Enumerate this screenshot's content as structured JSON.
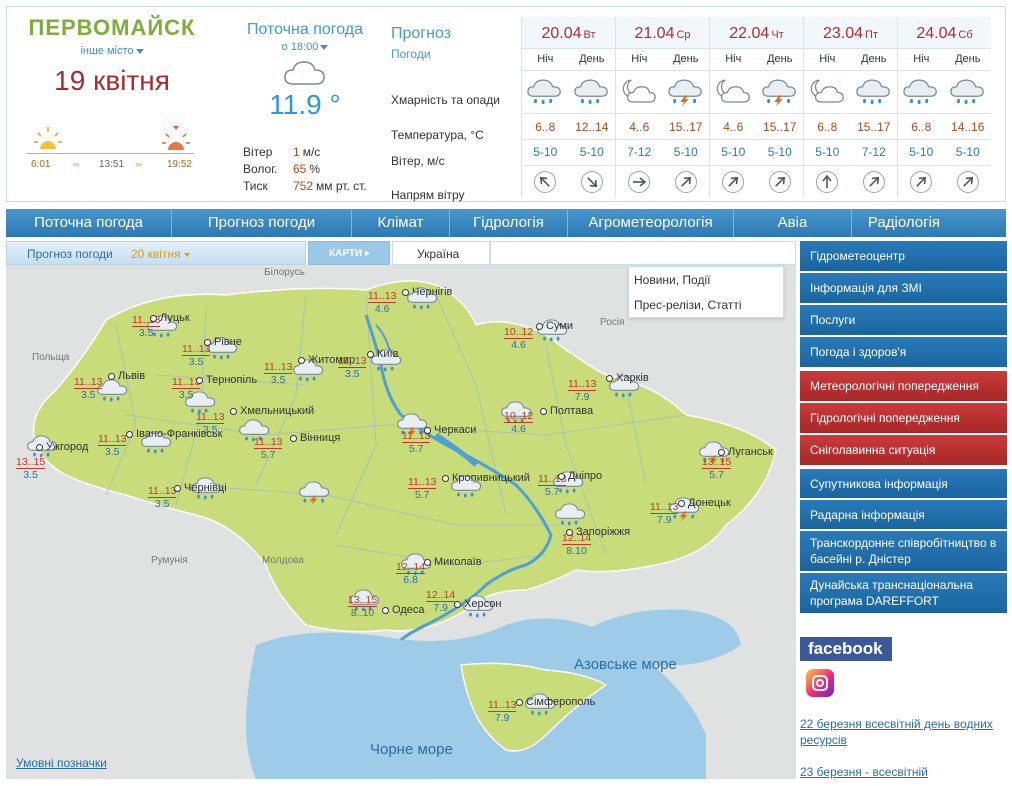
{
  "header": {
    "city": "ПЕРВОМАЙСК",
    "other_city": "інше місто",
    "date": "19 квітня",
    "sunrise": "6:01",
    "noon": "13:51",
    "sunset": "19:52"
  },
  "current": {
    "title": "Поточна погода",
    "time": "о 18:00",
    "temperature": "11.9 °",
    "wind_label": "Вітер",
    "wind_value": "1",
    "wind_unit": "м/с",
    "humidity_label": "Волог.",
    "humidity_value": "65",
    "humidity_unit": "%",
    "pressure_label": "Тиск",
    "pressure_value": "752",
    "pressure_unit": "мм рт. ст."
  },
  "forecast": {
    "title": "Прогноз",
    "subtitle": "Погоди",
    "row_clouds": "Хмарність та опади",
    "row_temp": "Температура, °С",
    "row_wind": "Вітер, м/с",
    "row_dir": "Напрям вітру",
    "night_label": "Ніч",
    "day_label": "День",
    "days": [
      {
        "date": "20.04",
        "dow": "Вт",
        "night": {
          "icon": "cloud-rain-icon",
          "temp": "6..8",
          "wind": "5-10",
          "dir": "nw"
        },
        "day": {
          "icon": "cloud-rain-icon",
          "temp": "12..14",
          "wind": "5-10",
          "dir": "se"
        }
      },
      {
        "date": "21.04",
        "dow": "Ср",
        "night": {
          "icon": "moon-cloud-icon",
          "temp": "4..6",
          "wind": "7-12",
          "dir": "e"
        },
        "day": {
          "icon": "cloud-thunder-icon",
          "temp": "15..17",
          "wind": "5-10",
          "dir": "ne"
        }
      },
      {
        "date": "22.04",
        "dow": "Чт",
        "night": {
          "icon": "moon-cloud-icon",
          "temp": "4..6",
          "wind": "5-10",
          "dir": "ne"
        },
        "day": {
          "icon": "cloud-thunder-icon",
          "temp": "15..17",
          "wind": "5-10",
          "dir": "ne"
        }
      },
      {
        "date": "23.04",
        "dow": "Пт",
        "night": {
          "icon": "moon-cloud-icon",
          "temp": "6..8",
          "wind": "5-10",
          "dir": "n"
        },
        "day": {
          "icon": "cloud-rain-icon",
          "temp": "15..17",
          "wind": "7-12",
          "dir": "ne"
        }
      },
      {
        "date": "24.04",
        "dow": "Сб",
        "night": {
          "icon": "cloud-rain-icon",
          "temp": "6..8",
          "wind": "5-10",
          "dir": "ne"
        },
        "day": {
          "icon": "cloud-rain-icon",
          "temp": "14..16",
          "wind": "5-10",
          "dir": "ne"
        }
      }
    ]
  },
  "nav": [
    "Поточна погода",
    "Прогноз погоди",
    "Клімат",
    "Гідрологія",
    "Агрометеорологія",
    "Авіа",
    "Радіологія"
  ],
  "subtabs": {
    "forecast_label": "Прогноз погоди",
    "forecast_date": "20 квітня",
    "maps_label": "КАРТИ",
    "region": "Україна"
  },
  "dropdown": [
    "Новини, Події",
    "Прес-релізи, Статті"
  ],
  "map": {
    "neighbors": [
      "Білорусь",
      "Польща",
      "Росія",
      "Румунія",
      "Молдова"
    ],
    "seas": [
      "Азовське море",
      "Чорне море"
    ],
    "legend_link": "Умовні позначки",
    "cities": [
      {
        "name": "Луцьк",
        "day": "11..13",
        "night": "3.5",
        "icon": "cloud-rain-icon"
      },
      {
        "name": "Рівне",
        "day": "11..13",
        "night": "3.5",
        "icon": "cloud-rain-icon"
      },
      {
        "name": "Чернігів",
        "day": "11..13",
        "night": "4.6",
        "icon": "cloud-rain-icon"
      },
      {
        "name": "Суми",
        "day": "10..12",
        "night": "4.6",
        "icon": "cloud-rain-icon"
      },
      {
        "name": "Київ",
        "day": "11..13",
        "night": "3.5",
        "icon": "cloud-rain-icon"
      },
      {
        "name": "Житомир",
        "day": "11..13",
        "night": "3.5",
        "icon": "cloud-rain-icon"
      },
      {
        "name": "Львів",
        "day": "11..13",
        "night": "3.5",
        "icon": "cloud-rain-icon"
      },
      {
        "name": "Тернопіль",
        "day": "11..13",
        "night": "3.5",
        "icon": "cloud-rain-icon"
      },
      {
        "name": "Харків",
        "day": "11..13",
        "night": "7.9",
        "icon": "cloud-rain-icon"
      },
      {
        "name": "Полтава",
        "day": "10..12",
        "night": "4.6",
        "icon": "cloud-rain-icon"
      },
      {
        "name": "Хмельницький",
        "day": "11..13",
        "night": "3.5",
        "icon": "cloud-rain-icon"
      },
      {
        "name": "Ужгород",
        "day": "13..15",
        "night": "3.5",
        "icon": "cloud-rain-icon"
      },
      {
        "name": "Івано-Франківськ",
        "day": "11..13",
        "night": "3.5",
        "icon": "cloud-rain-icon"
      },
      {
        "name": "Вінниця",
        "day": "11..13",
        "night": "5.7",
        "icon": "cloud-thunder-icon"
      },
      {
        "name": "Черкаси",
        "day": "11..13",
        "night": "5.7",
        "icon": "cloud-thunder-icon"
      },
      {
        "name": "Луганськ",
        "day": "13..15",
        "night": "5.7",
        "icon": "cloud-thunder-icon"
      },
      {
        "name": "Чернівці",
        "day": "11..13",
        "night": "3.5",
        "icon": "cloud-rain-icon"
      },
      {
        "name": "Кропивницький",
        "day": "11..13",
        "night": "5.7",
        "icon": "cloud-rain-icon"
      },
      {
        "name": "Дніпро",
        "day": "11..13",
        "night": "5.7",
        "icon": "cloud-rain-icon"
      },
      {
        "name": "Донецьк",
        "day": "11..13",
        "night": "7.9",
        "icon": "cloud-thunder-icon"
      },
      {
        "name": "Запоріжжя",
        "day": "12..14",
        "night": "8.10",
        "icon": "cloud-rain-icon"
      },
      {
        "name": "Миколаїв",
        "day": "12..14",
        "night": "6.8",
        "icon": "cloud-rain-icon"
      },
      {
        "name": "Одеса",
        "day": "13..15",
        "night": "8..10",
        "icon": "cloud-rain-icon"
      },
      {
        "name": "Херсон",
        "day": "12..14",
        "night": "7.9",
        "icon": "cloud-rain-icon"
      },
      {
        "name": "Сімферополь",
        "day": "11..13",
        "night": "7.9",
        "icon": "cloud-rain-icon"
      }
    ]
  },
  "sidebar": [
    {
      "label": "Гідрометеоцентр",
      "color": "blue"
    },
    {
      "label": "Інформація для ЗМІ",
      "color": "blue"
    },
    {
      "label": "Послуги",
      "color": "blue"
    },
    {
      "label": "Погода і здоров'я",
      "color": "blue"
    },
    {
      "label": "Метеорологічні попередження",
      "color": "red"
    },
    {
      "label": "Гідрологічні попередження",
      "color": "red"
    },
    {
      "label": "Сніголавинна ситуація",
      "color": "red"
    },
    {
      "label": "Супутникова інформація",
      "color": "blue"
    },
    {
      "label": "Радарна інформація",
      "color": "blue"
    },
    {
      "label": "Транскордонне співробітництво в басейні р. Дністер",
      "color": "blue"
    },
    {
      "label": "Дунайська транснаціональна програма DAREFFORT",
      "color": "blue"
    }
  ],
  "social": {
    "facebook": "facebook"
  },
  "news": [
    "22 березня всесвітній день водних ресурсів",
    "23 березня - всесвітній"
  ],
  "colors": {
    "nav": "#2b78b5",
    "red_item": "#b33030",
    "map_land": "#c8dc7a",
    "map_water": "#6cb5e3"
  }
}
